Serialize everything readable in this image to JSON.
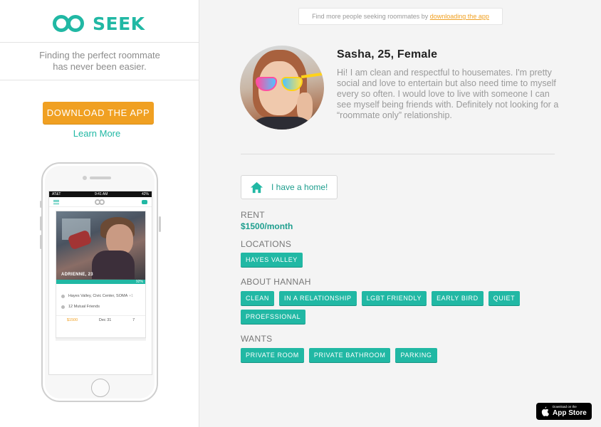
{
  "sidebar": {
    "logo_text": "SEEK",
    "tagline_line1": "Finding the perfect roommate",
    "tagline_line2": "has never been easier.",
    "download_button": "DOWNLOAD THE APP",
    "learn_more": "Learn More"
  },
  "phone": {
    "status_carrier": "AT&T",
    "status_time": "9:41 AM",
    "status_battery": "42%",
    "card": {
      "name": "ADRIENNE, 23",
      "match": "92%",
      "location": "Hayes Valley, Civic Center, SOMA",
      "location_more": "+1",
      "mutual_friends": "12 Mutual Friends",
      "price": "$1500",
      "date": "Dec 31",
      "count": "7"
    }
  },
  "promo": {
    "text": "Find more people seeking roommates by",
    "link": "downloading the app"
  },
  "profile": {
    "name": "Sasha, 25, Female",
    "bio": "Hi! I am clean and respectful to housemates. I'm pretty social and love to entertain but also need time to myself every so often. I would love to live with someone I can see myself being friends with. Definitely not looking for a “roommate only” relationship.",
    "home_button": "I have a home!",
    "rent_label": "RENT",
    "rent_value": "$1500/month",
    "locations_label": "LOCATIONS",
    "locations": [
      "HAYES VALLEY"
    ],
    "about_label": "ABOUT HANNAH",
    "about": [
      "CLEAN",
      "IN A RELATIONSHIP",
      "LGBT FRIENDLY",
      "EARLY BIRD",
      "QUIET",
      "PROEFSSIONAL"
    ],
    "wants_label": "WANTS",
    "wants": [
      "PRIVATE ROOM",
      "PRIVATE BATHROOM",
      "PARKING"
    ]
  },
  "appstore": {
    "small": "Download on the",
    "big": "App Store"
  },
  "colors": {
    "accent": "#21b8a4",
    "orange": "#f0a022"
  }
}
